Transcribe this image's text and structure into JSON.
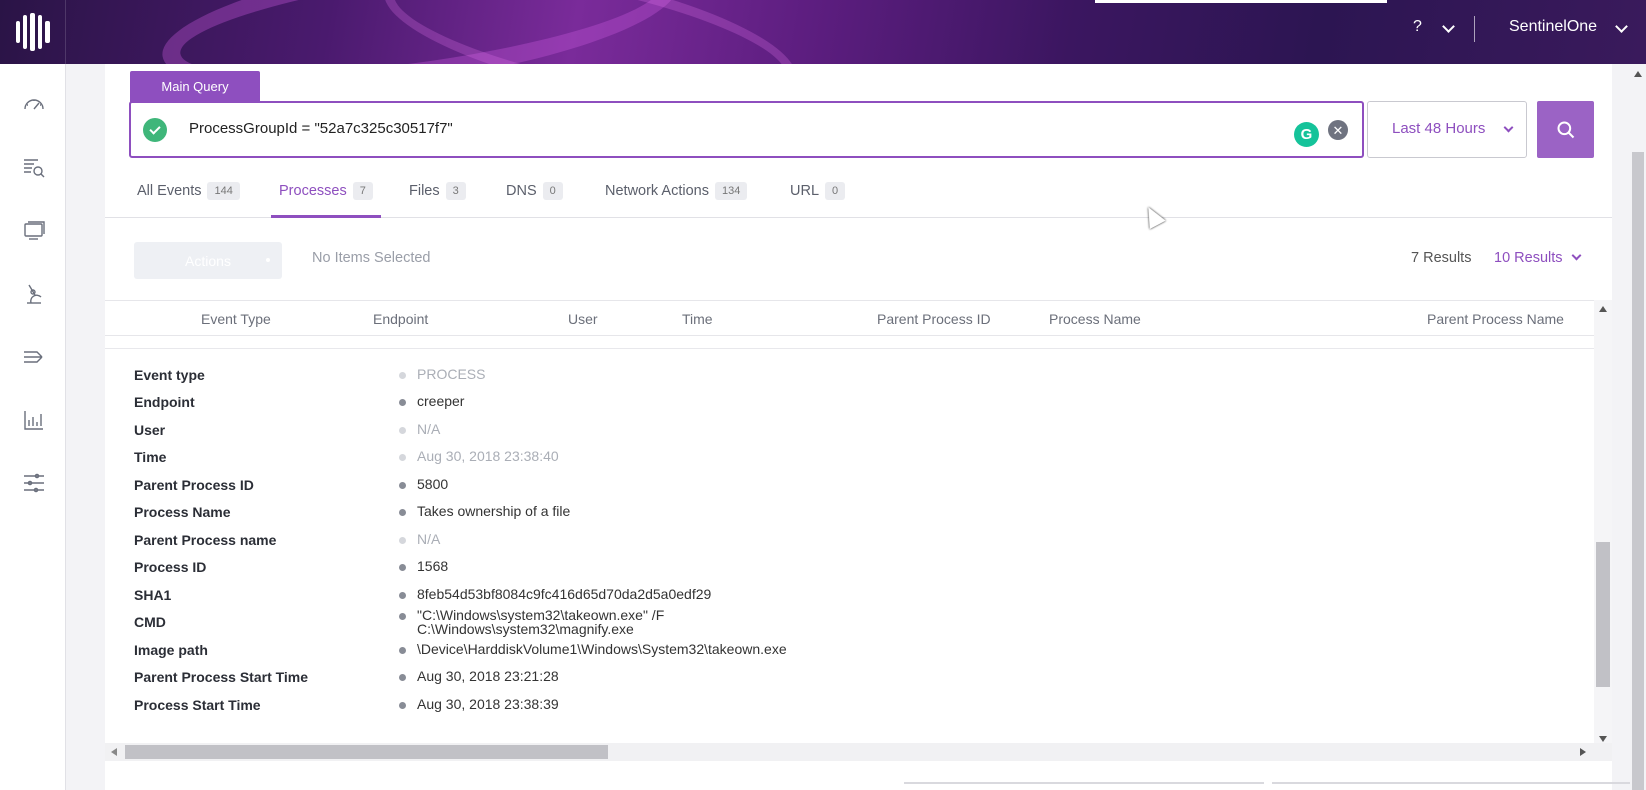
{
  "header": {
    "help_label": "?",
    "account_name": "SentinelOne"
  },
  "sidebar": {
    "items": [
      {
        "icon": "dashboard-icon"
      },
      {
        "icon": "visibility-search-icon"
      },
      {
        "icon": "devices-icon"
      },
      {
        "icon": "lab-flask-icon"
      },
      {
        "icon": "activity-icon"
      },
      {
        "icon": "reports-chart-icon"
      },
      {
        "icon": "settings-sliders-icon"
      }
    ]
  },
  "query": {
    "tab_label": "Main Query",
    "value": "ProcessGroupId = \"52a7c325c30517f7\"",
    "time_range": "Last 48 Hours"
  },
  "tabs": [
    {
      "label": "All Events",
      "count": "144"
    },
    {
      "label": "Processes",
      "count": "7"
    },
    {
      "label": "Files",
      "count": "3"
    },
    {
      "label": "DNS",
      "count": "0"
    },
    {
      "label": "Network Actions",
      "count": "134"
    },
    {
      "label": "URL",
      "count": "0"
    }
  ],
  "toolbar": {
    "actions_label": "Actions",
    "selection_status": "No Items Selected",
    "result_count": "7 Results",
    "per_page": "10 Results"
  },
  "table": {
    "columns": [
      "Event Type",
      "Endpoint",
      "User",
      "Time",
      "Parent Process ID",
      "Process Name",
      "Parent Process Name"
    ]
  },
  "detail": {
    "rows": [
      {
        "key": "Event type",
        "value": "PROCESS",
        "muted": true
      },
      {
        "key": "Endpoint",
        "value": "creeper",
        "muted": false
      },
      {
        "key": "User",
        "value": "N/A",
        "muted": true
      },
      {
        "key": "Time",
        "value": "Aug 30, 2018 23:38:40",
        "muted": true
      },
      {
        "key": "Parent Process ID",
        "value": "5800",
        "muted": false
      },
      {
        "key": "Process Name",
        "value": "Takes ownership of a file",
        "muted": false
      },
      {
        "key": "Parent Process name",
        "value": "N/A",
        "muted": true
      },
      {
        "key": "Process ID",
        "value": "1568",
        "muted": false
      },
      {
        "key": "SHA1",
        "value": "8feb54d53bf8084c9fc416d65d70da2d5a0edf29",
        "muted": false
      },
      {
        "key": "CMD",
        "value": "\"C:\\Windows\\system32\\takeown.exe\" /F",
        "value2": "C:\\Windows\\system32\\magnify.exe",
        "muted": false
      },
      {
        "key": "Image path",
        "value": "\\Device\\HarddiskVolume1\\Windows\\System32\\takeown.exe",
        "muted": false
      },
      {
        "key": "Parent Process Start Time",
        "value": "Aug 30, 2018 23:21:28",
        "muted": false
      },
      {
        "key": "Process Start Time",
        "value": "Aug 30, 2018 23:38:39",
        "muted": false
      }
    ]
  },
  "colors": {
    "accent": "#8e4fbf",
    "success": "#3fb67a",
    "grammarly": "#15c39a"
  }
}
